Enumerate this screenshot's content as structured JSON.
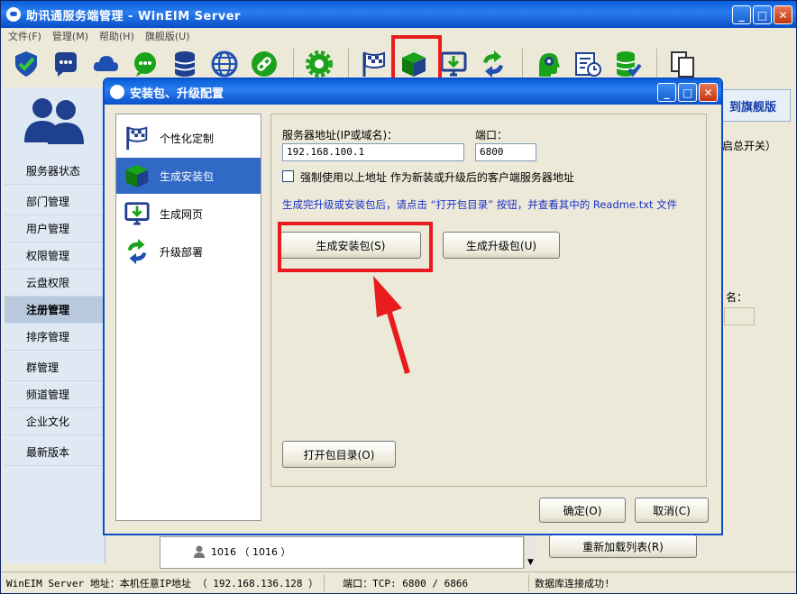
{
  "window": {
    "title": "助讯通服务端管理 - WinEIM Server"
  },
  "menu": [
    "文件(F)",
    "管理(M)",
    "帮助(H)",
    "旗舰版(U)"
  ],
  "sidebar": {
    "items": [
      {
        "label": "服务器状态"
      },
      {
        "label": "部门管理"
      },
      {
        "label": "用户管理"
      },
      {
        "label": "权限管理"
      },
      {
        "label": "云盘权限"
      },
      {
        "label": "注册管理"
      },
      {
        "label": "排序管理"
      },
      {
        "label": "群管理"
      },
      {
        "label": "频道管理"
      },
      {
        "label": "企业文化"
      },
      {
        "label": "最新版本"
      }
    ]
  },
  "right_panel": {
    "banner": "到旗舰版",
    "subtext": "启总开关）",
    "name_label": "名：",
    "reload_button": "重新加载列表(R)"
  },
  "list": {
    "row": "1016 （ 1016 ）"
  },
  "dialog": {
    "title": "安装包、升级配置",
    "nav": [
      "个性化定制",
      "生成安装包",
      "生成网页",
      "升级部署"
    ],
    "server_label": "服务器地址(IP或域名)：",
    "server_value": "192.168.100.1",
    "port_label": "端口：",
    "port_value": "6800",
    "force_label": "强制使用以上地址 作为新装或升级后的客户端服务器地址",
    "hint": "生成完升级或安装包后，请点击 “打开包目录” 按钮，并查看其中的 Readme.txt 文件",
    "gen_install": "生成安装包(S)",
    "gen_upgrade": "生成升级包(U)",
    "open_dir": "打开包目录(O)",
    "ok": "确定(O)",
    "cancel": "取消(C)"
  },
  "status": {
    "left": "WinEIM Server 地址：本机任意IP地址 （ 192.168.136.128 ）",
    "port": "端口：TCP: 6800 / 6866",
    "db": "数据库连接成功!"
  },
  "colors": {
    "accent_red": "#e81c1c",
    "title_blue": "#0a5fd8",
    "hint_blue": "#1a32c8",
    "green": "#1aa31a"
  }
}
